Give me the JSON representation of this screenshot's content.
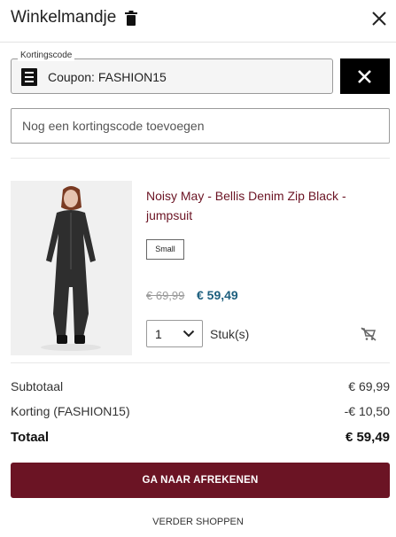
{
  "header": {
    "title": "Winkelmandje",
    "trash_icon": "trash-icon",
    "close_icon": "close-icon"
  },
  "coupon": {
    "legend": "Kortingscode",
    "icon": "receipt-icon",
    "applied_text": "Coupon: FASHION15",
    "remove_icon": "close-icon"
  },
  "code_input": {
    "placeholder": "Nog een kortingscode toevoegen",
    "value": ""
  },
  "product": {
    "title": "Noisy May - Bellis Denim Zip Black - jumpsuit",
    "size": "Small",
    "old_price": "€ 69,99",
    "new_price": "€ 59,49",
    "quantity": "1",
    "quantity_unit": "Stuk(s)",
    "remove_icon": "remove-from-cart-icon"
  },
  "totals": {
    "subtotal_label": "Subtotaal",
    "subtotal_value": "€ 69,99",
    "discount_label": "Korting (FASHION15)",
    "discount_value": "-€ 10,50",
    "total_label": "Totaal",
    "total_value": "€ 59,49"
  },
  "actions": {
    "checkout_label": "GA NAAR AFREKENEN",
    "continue_label": "VERDER SHOPPEN"
  },
  "colors": {
    "brand": "#6b1424",
    "sale_price": "#1d5f7e",
    "dark_button": "#000000"
  }
}
